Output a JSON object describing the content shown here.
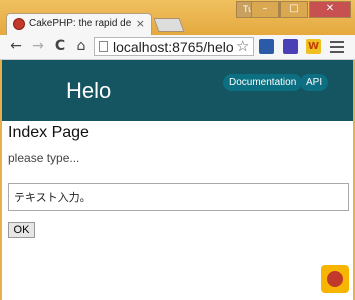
{
  "browser": {
    "user_name": "Tuyano",
    "tab_title": "CakePHP: the rapid dev",
    "tab_close": "×",
    "url": "localhost:8765/helo",
    "back_glyph": "←",
    "forward_glyph": "→",
    "reload_glyph": "C",
    "home_glyph": "⌂",
    "star_glyph": "☆",
    "ext_w_label": "W",
    "min_glyph": "–",
    "max_glyph": "□",
    "close_glyph": "✕"
  },
  "site": {
    "title": "Helo",
    "nav": [
      "Documentation",
      "API"
    ]
  },
  "main": {
    "heading": "Index Page",
    "hint": "please type...",
    "input_value": "テキスト入力。",
    "submit_label": "OK"
  },
  "colors": {
    "header_bg": "#155461",
    "pill_bg": "#0c6f82",
    "window_frame": "#e8b04a"
  },
  "icons": {
    "back": "arrow-left-icon",
    "forward": "arrow-right-icon",
    "reload": "reload-icon",
    "home": "home-icon",
    "star": "star-icon",
    "menu": "hamburger-menu-icon",
    "debug_kit": "cakephp-debugkit-icon"
  }
}
